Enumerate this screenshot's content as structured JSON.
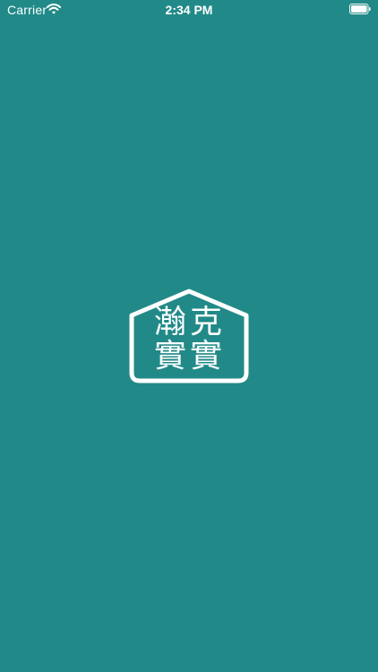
{
  "status_bar": {
    "carrier": "Carrier",
    "time": "2:34 PM",
    "wifi_icon": "wifi-icon",
    "battery_icon": "battery-icon"
  },
  "splash": {
    "logo_icon": "house-logo-icon",
    "logo_chars": [
      "瀚",
      "克",
      "實",
      "實"
    ]
  },
  "colors": {
    "background": "#218a88",
    "foreground": "#ffffff"
  }
}
